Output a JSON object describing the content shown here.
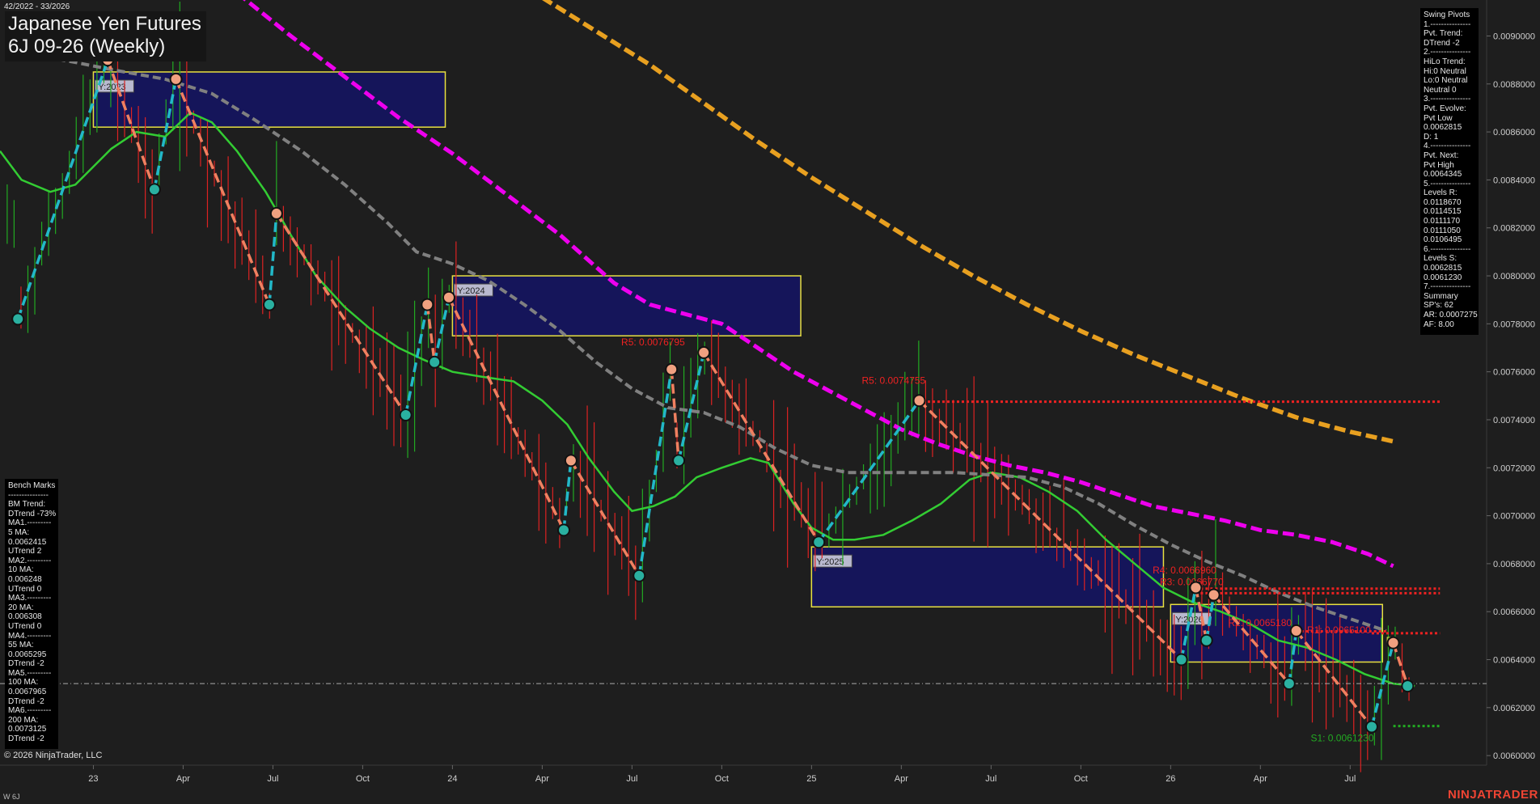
{
  "window": {
    "date_range": "42/2022 - 33/2026",
    "title_line1": "Japanese Yen Futures",
    "title_line2": "6J 09-26 (Weekly)",
    "copyright": "© 2026 NinjaTrader, LLC",
    "footer_label": "W 6J",
    "brand": "NINJATRADER"
  },
  "swing_panel": {
    "lines": [
      "Swing Pivots",
      "1.---------------",
      "Pvt. Trend:",
      "DTrend -2",
      "2.---------------",
      "HiLo Trend:",
      "Hi:0 Neutral",
      "Lo:0 Neutral",
      "Neutral 0",
      "3.---------------",
      "Pvt. Evolve:",
      "Pvt Low",
      "0.0062815",
      "D: 1",
      "4.---------------",
      "Pvt. Next:",
      "Pvt High",
      "0.0064345",
      "5.---------------",
      "Levels R:",
      "0.0118670",
      "0.0114515",
      "0.0111170",
      "0.0111050",
      "0.0106495",
      "6.---------------",
      "Levels S:",
      "0.0062815",
      "0.0061230",
      "7.---------------",
      "Summary",
      "SP's: 62",
      "AR: 0.0007275",
      "AF: 8.00"
    ]
  },
  "bench_panel": {
    "lines": [
      "Bench Marks",
      "---------------",
      "BM Trend:",
      "DTrend -73%",
      "MA1.---------",
      "5 MA:",
      "0.0062415",
      "UTrend 2",
      "MA2.---------",
      "10 MA:",
      "0.006248",
      "UTrend 0",
      "MA3.---------",
      "20 MA:",
      "0.006308",
      "UTrend 0",
      "MA4.---------",
      "55 MA:",
      "0.0065295",
      "DTrend -2",
      "MA5.---------",
      "100 MA:",
      "0.0067965",
      "DTrend -2",
      "MA6.---------",
      "200 MA:",
      "0.0073125",
      "DTrend -2"
    ]
  },
  "colors": {
    "background": "#1e1e1e",
    "bull_bar": "#22aa22",
    "bear_bar": "#dd2222",
    "ma_green": "#33cc33",
    "ma_gray": "#808080",
    "ma_magenta": "#ee00ee",
    "ma_orange": "#e8a020",
    "swing_down": "#f08060",
    "swing_up": "#22b8c8",
    "year_box_fill": "#15155a",
    "year_box_stroke": "#e8e040",
    "resistance": "#ee2222",
    "support": "#22aa22"
  },
  "chart_data": {
    "type": "line",
    "instrument": "6J 09-26",
    "timeframe": "Weekly",
    "ylim": [
      0.00596,
      0.00915
    ],
    "y_ticks": [
      "0.0060000",
      "0.0062000",
      "0.0064000",
      "0.0066000",
      "0.0068000",
      "0.0070000",
      "0.0072000",
      "0.0074000",
      "0.0076000",
      "0.0078000",
      "0.0080000",
      "0.0082000",
      "0.0084000",
      "0.0086000",
      "0.0088000",
      "0.0090000"
    ],
    "y_tick_values": [
      0.006,
      0.0062,
      0.0064,
      0.0066,
      0.0068,
      0.007,
      0.0072,
      0.0074,
      0.0076,
      0.0078,
      0.008,
      0.0082,
      0.0084,
      0.0086,
      0.0088,
      0.009
    ],
    "x_ticks": [
      {
        "label": "23",
        "t": 2023.0
      },
      {
        "label": "Apr",
        "t": 2023.25
      },
      {
        "label": "Jul",
        "t": 2023.5
      },
      {
        "label": "Oct",
        "t": 2023.75
      },
      {
        "label": "24",
        "t": 2024.0
      },
      {
        "label": "Apr",
        "t": 2024.25
      },
      {
        "label": "Jul",
        "t": 2024.5
      },
      {
        "label": "Oct",
        "t": 2024.75
      },
      {
        "label": "25",
        "t": 2025.0
      },
      {
        "label": "Apr",
        "t": 2025.25
      },
      {
        "label": "Jul",
        "t": 2025.5
      },
      {
        "label": "Oct",
        "t": 2025.75
      },
      {
        "label": "26",
        "t": 2026.0
      },
      {
        "label": "Apr",
        "t": 2026.25
      },
      {
        "label": "Jul",
        "t": 2026.5
      }
    ],
    "xlim": [
      2022.74,
      2026.88
    ],
    "price_line": 0.0063,
    "swings": [
      {
        "t": 2022.79,
        "p": 0.00782,
        "kind": "low"
      },
      {
        "t": 2023.04,
        "p": 0.0089,
        "kind": "high"
      },
      {
        "t": 2023.17,
        "p": 0.00836,
        "kind": "low"
      },
      {
        "t": 2023.23,
        "p": 0.00882,
        "kind": "high"
      },
      {
        "t": 2023.49,
        "p": 0.00788,
        "kind": "low"
      },
      {
        "t": 2023.51,
        "p": 0.00826,
        "kind": "high"
      },
      {
        "t": 2023.87,
        "p": 0.00742,
        "kind": "low"
      },
      {
        "t": 2023.93,
        "p": 0.00788,
        "kind": "high"
      },
      {
        "t": 2023.95,
        "p": 0.00764,
        "kind": "low"
      },
      {
        "t": 2023.99,
        "p": 0.00791,
        "kind": "high"
      },
      {
        "t": 2024.31,
        "p": 0.00694,
        "kind": "low"
      },
      {
        "t": 2024.33,
        "p": 0.00723,
        "kind": "high"
      },
      {
        "t": 2024.52,
        "p": 0.00675,
        "kind": "low"
      },
      {
        "t": 2024.61,
        "p": 0.00761,
        "kind": "high"
      },
      {
        "t": 2024.63,
        "p": 0.00723,
        "kind": "low"
      },
      {
        "t": 2024.7,
        "p": 0.00768,
        "kind": "high"
      },
      {
        "t": 2025.02,
        "p": 0.00689,
        "kind": "low"
      },
      {
        "t": 2025.3,
        "p": 0.00748,
        "kind": "high"
      },
      {
        "t": 2026.03,
        "p": 0.0064,
        "kind": "low"
      },
      {
        "t": 2026.07,
        "p": 0.0067,
        "kind": "high"
      },
      {
        "t": 2026.1,
        "p": 0.00648,
        "kind": "low"
      },
      {
        "t": 2026.12,
        "p": 0.00667,
        "kind": "high"
      },
      {
        "t": 2026.33,
        "p": 0.0063,
        "kind": "low"
      },
      {
        "t": 2026.35,
        "p": 0.00652,
        "kind": "high"
      },
      {
        "t": 2026.56,
        "p": 0.00612,
        "kind": "low"
      },
      {
        "t": 2026.62,
        "p": 0.00647,
        "kind": "high"
      },
      {
        "t": 2026.66,
        "p": 0.00629,
        "kind": "low"
      }
    ],
    "year_boxes": [
      {
        "label": "Y:2023",
        "t0": 2023.0,
        "t1": 2023.98,
        "p0": 0.00862,
        "p1": 0.00885
      },
      {
        "label": "Y:2024",
        "t0": 2024.0,
        "t1": 2024.97,
        "p0": 0.00775,
        "p1": 0.008
      },
      {
        "label": "Y:2025",
        "t0": 2025.0,
        "t1": 2025.98,
        "p0": 0.00662,
        "p1": 0.00687
      },
      {
        "label": "Y:2026",
        "t0": 2026.0,
        "t1": 2026.59,
        "p0": 0.00639,
        "p1": 0.00663
      }
    ],
    "levels": [
      {
        "label": "R5: 0.0074755",
        "p": 0.0074755,
        "t0": 2025.31,
        "t1": 2026.75,
        "kind": "resistance",
        "label_t": 2025.14,
        "label_p": 0.00755
      },
      {
        "label": "R5: 0.0076795",
        "p": 0.0076795,
        "t0": 2024.7,
        "t1": 2024.7,
        "kind": "resistance",
        "label_t": 2024.47,
        "label_p": 0.00771
      },
      {
        "label": "R4: 0.0066960",
        "p": 0.006696,
        "t0": 2026.07,
        "t1": 2026.75,
        "kind": "resistance",
        "label_t": 2025.95,
        "label_p": 0.00676
      },
      {
        "label": "R3: 0.0066770",
        "p": 0.006677,
        "t0": 2026.07,
        "t1": 2026.75,
        "kind": "resistance",
        "label_t": 2025.97,
        "label_p": 0.00671
      },
      {
        "label": "R2: 0.0065180",
        "p": 0.006518,
        "t0": 2026.35,
        "t1": 2026.6,
        "kind": "resistance",
        "label_t": 2026.16,
        "label_p": 0.00654
      },
      {
        "label": "R1: 0.0065100",
        "p": 0.00651,
        "t0": 2026.56,
        "t1": 2026.75,
        "kind": "resistance",
        "label_t": 2026.38,
        "label_p": 0.00651
      },
      {
        "label": "S1: 0.0061230",
        "p": 0.006123,
        "t0": 2026.62,
        "t1": 2026.75,
        "kind": "support",
        "label_t": 2026.39,
        "label_p": 0.00606
      }
    ],
    "f0_label": {
      "label": "F0",
      "t": 2026.6,
      "p": 0.00647
    },
    "moving_averages": [
      {
        "name": "5 MA",
        "color": "#22aa22",
        "points": []
      },
      {
        "name": "20 MA",
        "color": "#33cc33",
        "points": [
          [
            2022.74,
            0.00852
          ],
          [
            2022.8,
            0.0084
          ],
          [
            2022.88,
            0.00835
          ],
          [
            2022.95,
            0.00838
          ],
          [
            2023.05,
            0.00853
          ],
          [
            2023.12,
            0.0086
          ],
          [
            2023.2,
            0.00858
          ],
          [
            2023.27,
            0.00868
          ],
          [
            2023.33,
            0.00864
          ],
          [
            2023.4,
            0.00852
          ],
          [
            2023.48,
            0.00835
          ],
          [
            2023.55,
            0.00817
          ],
          [
            2023.62,
            0.008
          ],
          [
            2023.7,
            0.00787
          ],
          [
            2023.77,
            0.00778
          ],
          [
            2023.85,
            0.0077
          ],
          [
            2023.92,
            0.00765
          ],
          [
            2024.0,
            0.0076
          ],
          [
            2024.08,
            0.00758
          ],
          [
            2024.17,
            0.00756
          ],
          [
            2024.25,
            0.00748
          ],
          [
            2024.32,
            0.00738
          ],
          [
            2024.38,
            0.00724
          ],
          [
            2024.45,
            0.0071
          ],
          [
            2024.5,
            0.00702
          ],
          [
            2024.56,
            0.00704
          ],
          [
            2024.62,
            0.00708
          ],
          [
            2024.68,
            0.00716
          ],
          [
            2024.75,
            0.0072
          ],
          [
            2024.83,
            0.00724
          ],
          [
            2024.88,
            0.00722
          ],
          [
            2024.95,
            0.00705
          ],
          [
            2025.0,
            0.00695
          ],
          [
            2025.06,
            0.0069
          ],
          [
            2025.12,
            0.0069
          ],
          [
            2025.2,
            0.00692
          ],
          [
            2025.28,
            0.00698
          ],
          [
            2025.36,
            0.00705
          ],
          [
            2025.44,
            0.00715
          ],
          [
            2025.5,
            0.00718
          ],
          [
            2025.58,
            0.00716
          ],
          [
            2025.66,
            0.0071
          ],
          [
            2025.74,
            0.00702
          ],
          [
            2025.82,
            0.0069
          ],
          [
            2025.9,
            0.0068
          ],
          [
            2025.98,
            0.0067
          ],
          [
            2026.06,
            0.00664
          ],
          [
            2026.14,
            0.0066
          ],
          [
            2026.22,
            0.00655
          ],
          [
            2026.3,
            0.00648
          ],
          [
            2026.38,
            0.00645
          ],
          [
            2026.46,
            0.0064
          ],
          [
            2026.54,
            0.00634
          ],
          [
            2026.62,
            0.0063
          ],
          [
            2026.68,
            0.00629
          ]
        ]
      },
      {
        "name": "55 MA",
        "color": "#808080",
        "points": [
          [
            2022.8,
            0.00893
          ],
          [
            2022.95,
            0.00889
          ],
          [
            2023.05,
            0.00886
          ],
          [
            2023.2,
            0.00882
          ],
          [
            2023.33,
            0.00876
          ],
          [
            2023.45,
            0.00865
          ],
          [
            2023.58,
            0.00852
          ],
          [
            2023.7,
            0.00838
          ],
          [
            2023.82,
            0.00822
          ],
          [
            2023.9,
            0.0081
          ],
          [
            2024.0,
            0.00805
          ],
          [
            2024.1,
            0.00798
          ],
          [
            2024.2,
            0.00788
          ],
          [
            2024.3,
            0.00777
          ],
          [
            2024.4,
            0.00764
          ],
          [
            2024.5,
            0.00753
          ],
          [
            2024.6,
            0.00745
          ],
          [
            2024.7,
            0.00743
          ],
          [
            2024.8,
            0.00737
          ],
          [
            2024.9,
            0.00728
          ],
          [
            2025.0,
            0.00721
          ],
          [
            2025.1,
            0.00718
          ],
          [
            2025.2,
            0.00718
          ],
          [
            2025.3,
            0.00718
          ],
          [
            2025.4,
            0.00718
          ],
          [
            2025.5,
            0.00717
          ],
          [
            2025.6,
            0.00716
          ],
          [
            2025.7,
            0.00712
          ],
          [
            2025.8,
            0.00705
          ],
          [
            2025.9,
            0.00696
          ],
          [
            2026.0,
            0.00688
          ],
          [
            2026.1,
            0.00681
          ],
          [
            2026.2,
            0.00675
          ],
          [
            2026.3,
            0.00668
          ],
          [
            2026.4,
            0.00662
          ],
          [
            2026.5,
            0.00657
          ],
          [
            2026.6,
            0.00652
          ]
        ]
      },
      {
        "name": "100 MA",
        "color": "#ee00ee",
        "points": [
          [
            2023.4,
            0.00918
          ],
          [
            2023.55,
            0.009
          ],
          [
            2023.7,
            0.00883
          ],
          [
            2023.85,
            0.00866
          ],
          [
            2024.0,
            0.00851
          ],
          [
            2024.15,
            0.00834
          ],
          [
            2024.3,
            0.00817
          ],
          [
            2024.45,
            0.00797
          ],
          [
            2024.55,
            0.00788
          ],
          [
            2024.65,
            0.00784
          ],
          [
            2024.75,
            0.0078
          ],
          [
            2024.85,
            0.0077
          ],
          [
            2024.95,
            0.0076
          ],
          [
            2025.05,
            0.00752
          ],
          [
            2025.15,
            0.00744
          ],
          [
            2025.25,
            0.00736
          ],
          [
            2025.35,
            0.0073
          ],
          [
            2025.45,
            0.00725
          ],
          [
            2025.55,
            0.00721
          ],
          [
            2025.65,
            0.00718
          ],
          [
            2025.75,
            0.00714
          ],
          [
            2025.85,
            0.00709
          ],
          [
            2025.95,
            0.00704
          ],
          [
            2026.05,
            0.00701
          ],
          [
            2026.15,
            0.00698
          ],
          [
            2026.25,
            0.00694
          ],
          [
            2026.35,
            0.00692
          ],
          [
            2026.45,
            0.00689
          ],
          [
            2026.55,
            0.00684
          ],
          [
            2026.62,
            0.00679
          ]
        ]
      },
      {
        "name": "200 MA",
        "color": "#e8a020",
        "points": [
          [
            2024.25,
            0.00916
          ],
          [
            2024.4,
            0.00902
          ],
          [
            2024.55,
            0.00888
          ],
          [
            2024.7,
            0.00872
          ],
          [
            2024.85,
            0.00856
          ],
          [
            2025.0,
            0.00841
          ],
          [
            2025.15,
            0.00827
          ],
          [
            2025.3,
            0.00813
          ],
          [
            2025.45,
            0.008
          ],
          [
            2025.6,
            0.00788
          ],
          [
            2025.75,
            0.00777
          ],
          [
            2025.9,
            0.00767
          ],
          [
            2026.05,
            0.00758
          ],
          [
            2026.2,
            0.00749
          ],
          [
            2026.35,
            0.00741
          ],
          [
            2026.5,
            0.00735
          ],
          [
            2026.62,
            0.00731
          ]
        ]
      }
    ]
  }
}
